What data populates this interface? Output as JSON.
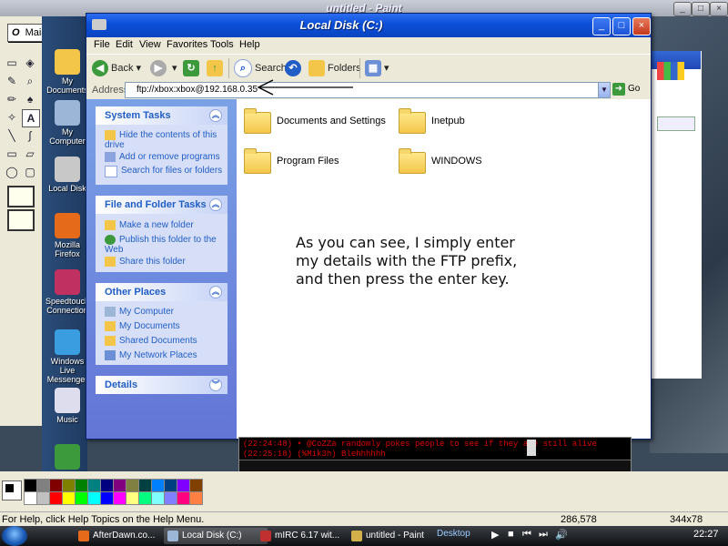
{
  "paint": {
    "title": "untitled - Paint",
    "font_name": "Maiandra GD",
    "font_prefix": "O",
    "status_help": "For Help, click Help Topics on the Help Menu.",
    "status_coords": "286,578",
    "status_size": "344x78"
  },
  "desktop_icons": [
    {
      "label": "My Documents",
      "icon": "folder-icon",
      "color": "#f3c64a"
    },
    {
      "label": "My Computer",
      "icon": "computer-icon",
      "color": "#9cb6d8"
    },
    {
      "label": "Local Disk",
      "icon": "disk-icon",
      "color": "#c8c8c8"
    },
    {
      "label": "Mozilla Firefox",
      "icon": "firefox-icon",
      "color": "#e56a1a"
    },
    {
      "label": "Speedtouch Connection",
      "icon": "network-icon",
      "color": "#c03060"
    },
    {
      "label": "Windows Live Messenger",
      "icon": "messenger-icon",
      "color": "#3a9de0"
    },
    {
      "label": "Music",
      "icon": "music-icon",
      "color": "#dde"
    },
    {
      "label": "uTorrent",
      "icon": "utorrent-icon",
      "color": "#3c9a3c"
    }
  ],
  "explorer": {
    "title": "Local Disk (C:)",
    "menu": [
      "File",
      "Edit",
      "View",
      "Favorites",
      "Tools",
      "Help"
    ],
    "toolbar": {
      "back": "Back",
      "search": "Search",
      "folders": "Folders"
    },
    "address_label": "Address",
    "address_value": "ftp://xbox:xbox@192.168.0.35",
    "go_label": "Go",
    "panels": [
      {
        "title": "System Tasks",
        "items": [
          "Hide the contents of this drive",
          "Add or remove programs",
          "Search for files or folders"
        ]
      },
      {
        "title": "File and Folder Tasks",
        "items": [
          "Make a new folder",
          "Publish this folder to the Web",
          "Share this folder"
        ]
      },
      {
        "title": "Other Places",
        "items": [
          "My Computer",
          "My Documents",
          "Shared Documents",
          "My Network Places"
        ]
      },
      {
        "title": "Details",
        "items": []
      }
    ],
    "folders": [
      "Documents and Settings",
      "Inetpub",
      "Program Files",
      "WINDOWS"
    ],
    "annotation": [
      "As you can see, I simply enter",
      "my details with the FTP prefix,",
      "and then press the enter key."
    ]
  },
  "mirc": {
    "lines": [
      "(22:24:48) • @CoZZa randomly pokes people to see if they are still alive",
      "(22:25:18) (%Mik3h) Blehhhhhh"
    ]
  },
  "taskbar": {
    "items": [
      {
        "label": "AfterDawn.co...",
        "color": "#e56a1a"
      },
      {
        "label": "Local Disk (C:)",
        "color": "#9cb6d8"
      },
      {
        "label": "mIRC 6.17 wit...",
        "color": "#c03030"
      },
      {
        "label": "untitled - Paint",
        "color": "#d4b04a"
      }
    ],
    "desktop_label": "Desktop",
    "clock": "22:27"
  },
  "palette": [
    "#000000",
    "#808080",
    "#800000",
    "#808000",
    "#008000",
    "#008080",
    "#000080",
    "#800080",
    "#808040",
    "#004040",
    "#0080ff",
    "#004080",
    "#8000ff",
    "#804000",
    "#ffffff",
    "#c0c0c0",
    "#ff0000",
    "#ffff00",
    "#00ff00",
    "#00ffff",
    "#0000ff",
    "#ff00ff",
    "#ffff80",
    "#00ff80",
    "#80ffff",
    "#8080ff",
    "#ff0080",
    "#ff8040"
  ]
}
